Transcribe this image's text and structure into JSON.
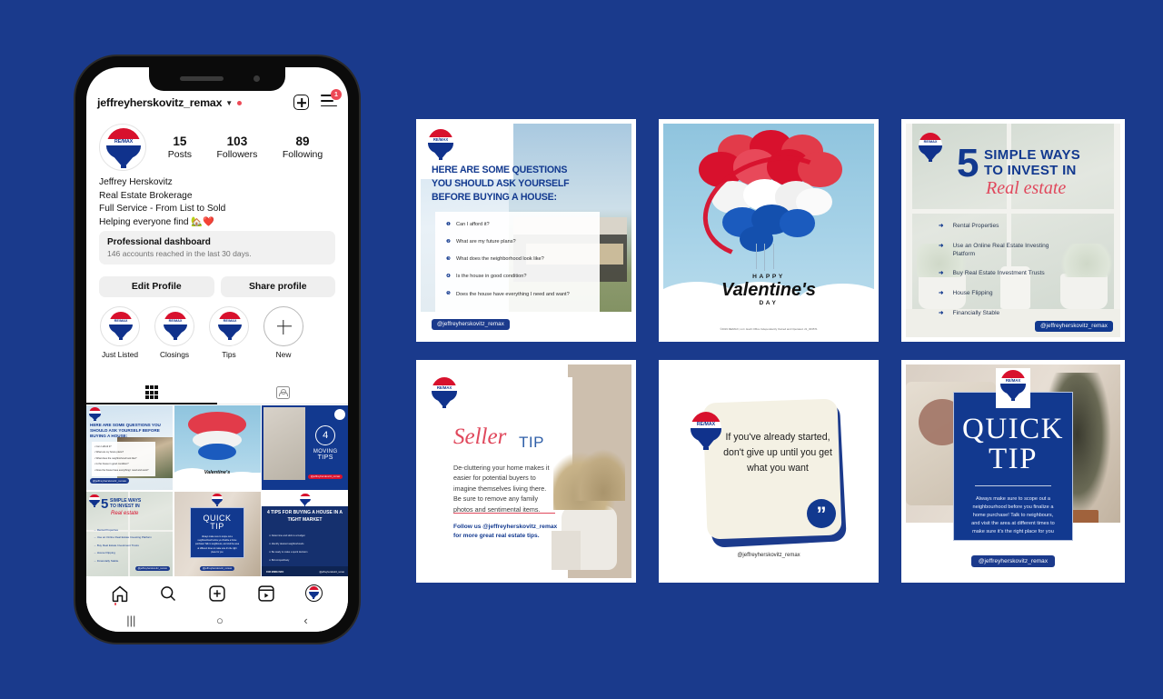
{
  "background_color": "#1A3A8C",
  "brand": {
    "name": "RE/MAX",
    "logo_text": "RE/MAX",
    "red": "#D8112D",
    "blue": "#10328C",
    "white": "#FFFFFF"
  },
  "phone": {
    "app": "Instagram",
    "header": {
      "username": "jeffreyherskovitz_remax",
      "chevron": "chevron-down-icon",
      "has_unread_dot": true,
      "add_icon": "plus-box-icon",
      "menu_icon": "hamburger-menu-icon",
      "menu_badge": "1"
    },
    "profile": {
      "avatar_alt": "RE/MAX balloon logo",
      "stats": [
        {
          "num": "15",
          "label": "Posts"
        },
        {
          "num": "103",
          "label": "Followers"
        },
        {
          "num": "89",
          "label": "Following"
        }
      ],
      "bio_lines": [
        "Jeffrey Herskovitz",
        "Real Estate Brokerage",
        "Full Service - From List to Sold",
        "Helping everyone find 🏡❤️"
      ]
    },
    "dashboard": {
      "title": "Professional dashboard",
      "subtitle": "146 accounts reached in the last 30 days."
    },
    "buttons": [
      {
        "label": "Edit Profile"
      },
      {
        "label": "Share profile"
      }
    ],
    "highlights": [
      {
        "label": "Just Listed",
        "type": "remax"
      },
      {
        "label": "Closings",
        "type": "remax"
      },
      {
        "label": "Tips",
        "type": "remax"
      },
      {
        "label": "New",
        "type": "new"
      }
    ],
    "tabs": [
      {
        "name": "grid-tab",
        "icon": "grid-icon",
        "active": true
      },
      {
        "name": "tagged-tab",
        "icon": "tagged-person-icon",
        "active": false
      }
    ],
    "grid_posts": [
      {
        "id": "questions",
        "title": "HERE ARE SOME QUESTIONS YOU SHOULD ASK YOURSELF BEFORE BUYING A HOUSE:"
      },
      {
        "id": "valentines",
        "title": "HAPPY Valentine's DAY"
      },
      {
        "id": "moving-tips",
        "title": "4 MOVING TIPS"
      },
      {
        "id": "five-ways",
        "title": "5 SIMPLE WAYS TO INVEST IN Real estate"
      },
      {
        "id": "quick-tip",
        "title": "QUICK TIP"
      },
      {
        "id": "tight-market",
        "title": "4 TIPS FOR BUYING A HOUSE IN A TIGHT MARKET"
      }
    ],
    "bottom_nav": [
      {
        "name": "home-icon",
        "label": "Home",
        "active": true,
        "dot": true
      },
      {
        "name": "search-icon",
        "label": "Search",
        "active": false,
        "dot": false
      },
      {
        "name": "create-icon",
        "label": "Create",
        "active": false,
        "dot": false
      },
      {
        "name": "reels-icon",
        "label": "Reels",
        "active": false,
        "dot": false
      },
      {
        "name": "profile-avatar",
        "label": "Profile",
        "active": true,
        "dot": false
      }
    ],
    "system_nav": [
      {
        "name": "recents-button",
        "glyph": "|||"
      },
      {
        "name": "home-button",
        "glyph": "○"
      },
      {
        "name": "back-button",
        "glyph": "‹"
      }
    ]
  },
  "handle": "@jeffreyherskovitz_remax",
  "cards": {
    "questions": {
      "headline_lines": [
        "HERE ARE SOME QUESTIONS",
        "YOU SHOULD ASK YOURSELF",
        "BEFORE BUYING A HOUSE:"
      ],
      "items": [
        "Can I afford it?",
        "What are my future plans?",
        "What does the neighborhood look like?",
        "Is the house in good condition?",
        "Does the house have everything I need and want?"
      ],
      "handle": "@jeffreyherskovitz_remax"
    },
    "valentines": {
      "greeting_small": "HAPPY",
      "greeting_script": "Valentine's",
      "greeting_sub": "DAY",
      "fineprint": "©2019 RE/MAX, LLC. Each Office Independently Owned and Operated. 21_303571"
    },
    "five_ways": {
      "number": "5",
      "line1": "SIMPLE WAYS",
      "line2": "TO INVEST IN",
      "script": "Real estate",
      "items": [
        "Rental Properties",
        "Use an Online Real Estate Investing Platform",
        "Buy Real Estate Investment Trusts",
        "House Flipping",
        "Financially Stable"
      ],
      "handle": "@jeffreyherskovitz_remax"
    },
    "seller_tip": {
      "script": "Seller",
      "title": "TIP",
      "body": "De-cluttering your home makes it easier for potential buyers to imagine themselves living there. Be sure to remove any family photos and sentimental items.",
      "cta_line1": "Follow us @jeffreyherskovitz_remax",
      "cta_line2": "for more great real estate tips."
    },
    "quote": {
      "text": "If you've already started, don't give up until you get what you want",
      "quote_mark": "”",
      "handle": "@jeffreyherskovitz_remax"
    },
    "quick_tip": {
      "title_line1": "QUICK",
      "title_line2": "TIP",
      "body": "Always make sure to scope out a neighbourhood before you finalize a home purchase! Talk to neighbours, and visit the area at different times to make sure it's the right place for you",
      "handle": "@jeffreyherskovitz_remax"
    }
  }
}
